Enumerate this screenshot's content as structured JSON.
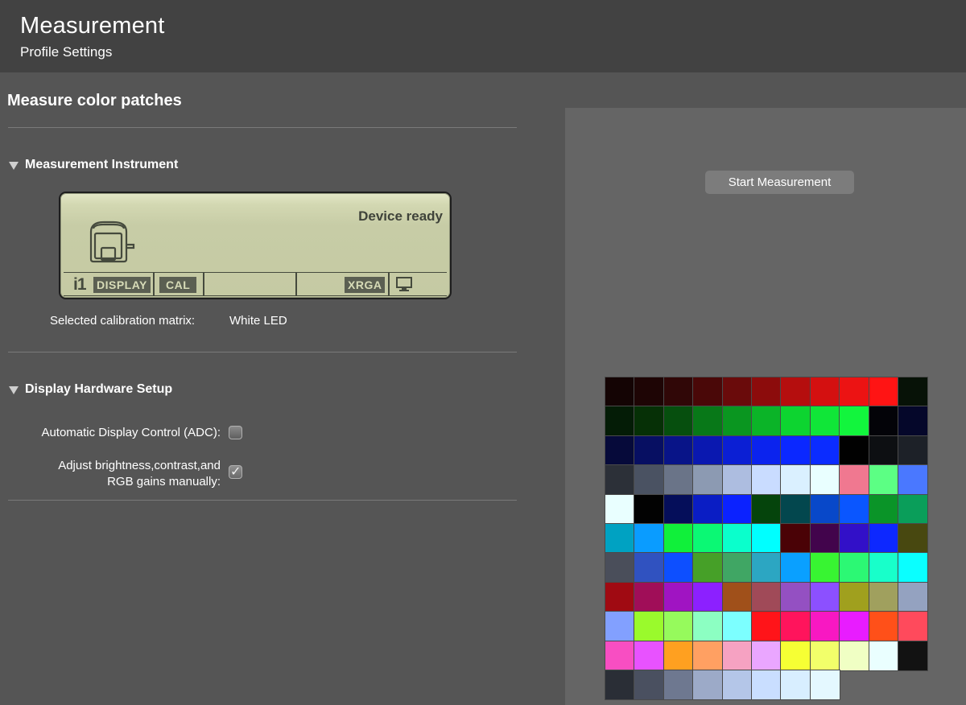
{
  "header": {
    "title": "Measurement",
    "subtitle": "Profile Settings"
  },
  "main": {
    "section_title": "Measure color patches",
    "instrument": {
      "group_label": "Measurement Instrument",
      "lcd": {
        "status": "Device ready",
        "brand": "i1",
        "model_badge": "DISPLAY",
        "cal_badge": "CAL",
        "mode_badge": "XRGA",
        "device_icon": "instrument-icon",
        "monitor_icon": "monitor-icon"
      },
      "matrix_label": "Selected calibration matrix:",
      "matrix_value": "White LED"
    },
    "hardware": {
      "group_label": "Display Hardware Setup",
      "adc_label": "Automatic Display Control (ADC):",
      "adc_checked": false,
      "manual_label_line1": "Adjust brightness,contrast,and",
      "manual_label_line2": "RGB gains manually:",
      "manual_checked": true
    }
  },
  "right_panel": {
    "start_button": "Start Measurement",
    "patches": [
      [
        "#140404",
        "#1e0505",
        "#300707",
        "#4a0808",
        "#6a0b0b",
        "#8c0c0c",
        "#b50e0e",
        "#d41010",
        "#ec1313",
        "#ff1414",
        "#071207"
      ],
      [
        "#041c06",
        "#063006",
        "#064f0e",
        "#087818",
        "#0a9620",
        "#0bb428",
        "#0dd430",
        "#10e638",
        "#12f53d",
        "#030308",
        "#05072a"
      ],
      [
        "#060a3a",
        "#070f62",
        "#081488",
        "#0a18b0",
        "#0b1fd4",
        "#0b23ee",
        "#0b28ff",
        "#0b2cff",
        "#010101",
        "#0d0f12",
        "#1d2128"
      ],
      [
        "#2c3038",
        "#4a5262",
        "#6a7488",
        "#8c9ab2",
        "#adbde0",
        "#c9dcff",
        "#daf0ff",
        "#e9ffff",
        "#f07890",
        "#5cff84",
        "#4a78ff"
      ],
      [
        "#e9ffff",
        "#020202",
        "#050e5a",
        "#0a1dc4",
        "#0b22ff",
        "#05440c",
        "#03474e",
        "#0848c9",
        "#0a56ff",
        "#0a9428",
        "#0a9e5a"
      ],
      [
        "#00a2c2",
        "#0a9cff",
        "#10f03a",
        "#0bf874",
        "#0affcc",
        "#00ffff",
        "#4a0206",
        "#42044c",
        "#3210c8",
        "#0d28ff",
        "#484810"
      ],
      [
        "#4a4e5a",
        "#3052c0",
        "#0d4fff",
        "#46a028",
        "#40a664",
        "#2ca6c2",
        "#0aa0ff",
        "#38f432",
        "#2cf874",
        "#18ffca",
        "#0affff"
      ],
      [
        "#a00a12",
        "#a00e58",
        "#a014c2",
        "#8c20ff",
        "#a0501a",
        "#a04a58",
        "#9450c2",
        "#8c50ff",
        "#a0a01e",
        "#a0a05e",
        "#94a2c0"
      ],
      [
        "#82a0ff",
        "#9afa2c",
        "#96fa5c",
        "#8cffc2",
        "#7cffff",
        "#ff1419",
        "#ff145c",
        "#f818c2",
        "#e81cff",
        "#ff5019",
        "#ff4a5c"
      ],
      [
        "#f84ec2",
        "#e852ff",
        "#ffa020",
        "#ffa062",
        "#f6a2c2",
        "#eaa6ff",
        "#f6ff34",
        "#f2ff6a",
        "#f0ffc4",
        "#eaffff",
        "#121212"
      ],
      [
        "#2a2e36",
        "#4a5060",
        "#6e7890",
        "#9caac8",
        "#b4c6e8",
        "#c9deff",
        "#d8eeff",
        "#e4f8ff"
      ]
    ]
  }
}
